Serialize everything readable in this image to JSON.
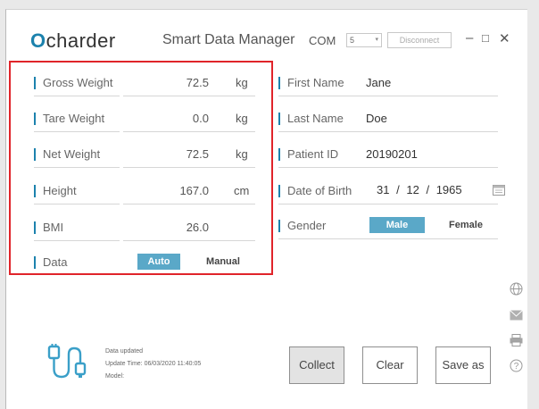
{
  "header": {
    "logo_text": "charder",
    "logo_o": "O",
    "app_title": "Smart Data Manager",
    "com_label": "COM",
    "com_value": "5",
    "disconnect_label": "Disconnect",
    "minimize": "–",
    "restore": "□",
    "close": "✕"
  },
  "left_fields": [
    {
      "label": "Gross Weight",
      "value": "72.5",
      "unit": "kg"
    },
    {
      "label": "Tare Weight",
      "value": "0.0",
      "unit": "kg"
    },
    {
      "label": "Net Weight",
      "value": "72.5",
      "unit": "kg"
    },
    {
      "label": "Height",
      "value": "167.0",
      "unit": "cm"
    },
    {
      "label": "BMI",
      "value": "26.0",
      "unit": ""
    }
  ],
  "data_mode": {
    "label": "Data",
    "auto": "Auto",
    "manual": "Manual",
    "selected": "Auto"
  },
  "right_fields": [
    {
      "label": "First Name",
      "value": "Jane"
    },
    {
      "label": "Last Name",
      "value": "Doe"
    },
    {
      "label": "Patient ID",
      "value": "20190201"
    }
  ],
  "dob": {
    "label": "Date of Birth",
    "day": "31",
    "month": "12",
    "year": "1965",
    "sep": "/"
  },
  "gender": {
    "label": "Gender",
    "male": "Male",
    "female": "Female",
    "selected": "Male"
  },
  "status": {
    "line1": "Data updated",
    "line2": "Update Time: 06/03/2020 11:40:05",
    "line3": "Model:"
  },
  "buttons": {
    "collect": "Collect",
    "clear": "Clear",
    "save": "Save as"
  },
  "side_icons": [
    "globe-icon",
    "mail-icon",
    "print-icon",
    "help-icon"
  ],
  "colors": {
    "accent": "#1c82ad",
    "toggle_on": "#5aa8c8",
    "highlight": "#e0242a"
  }
}
